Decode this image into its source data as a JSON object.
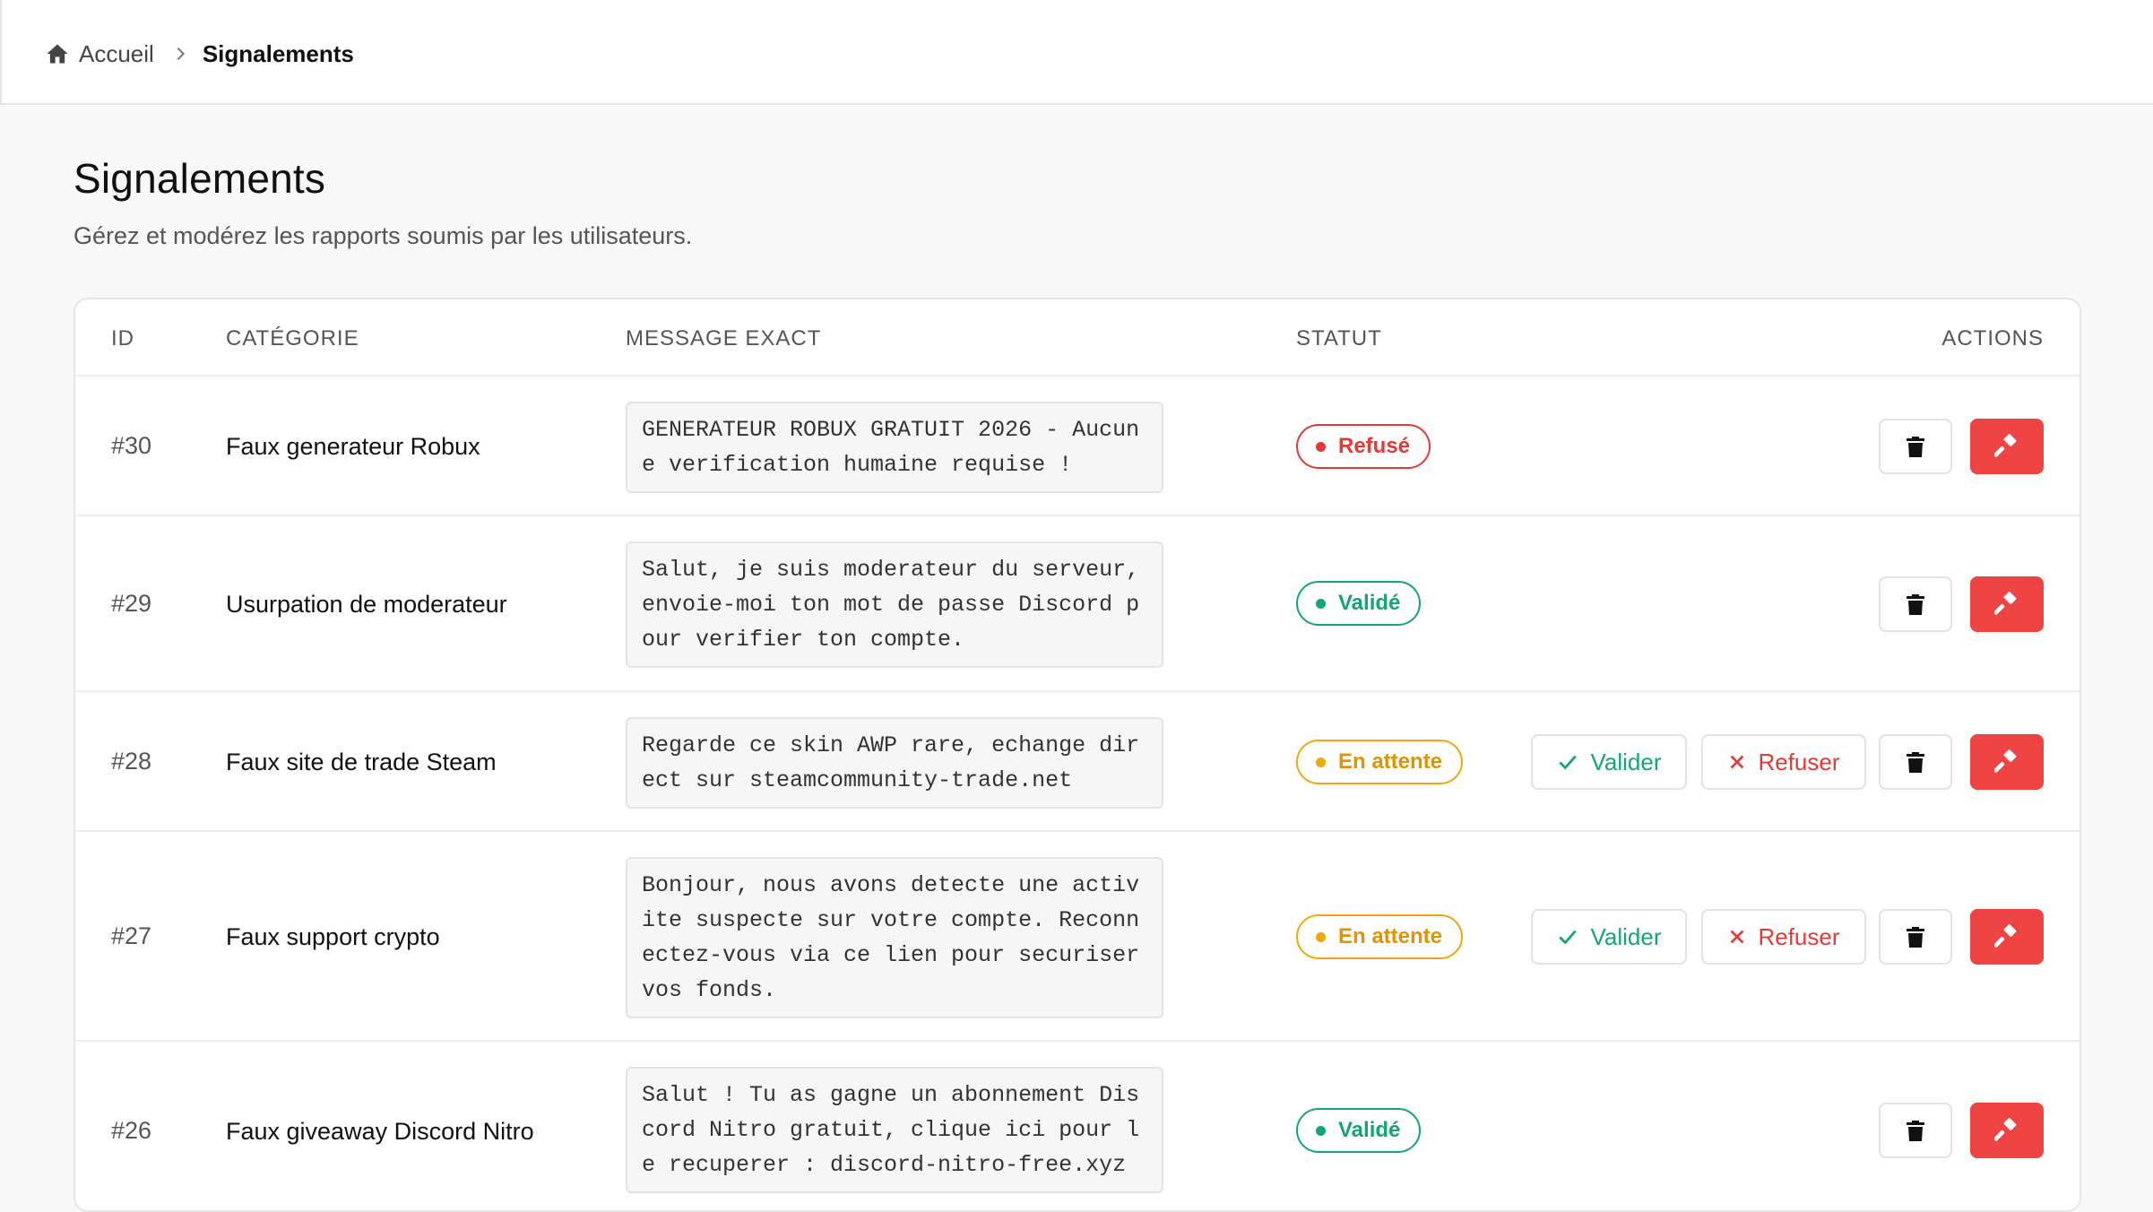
{
  "breadcrumb": {
    "home_label": "Accueil",
    "current_label": "Signalements"
  },
  "header": {
    "title": "Signalements",
    "subtitle": "Gérez et modérez les rapports soumis par les utilisateurs."
  },
  "table": {
    "columns": {
      "id": "ID",
      "category": "CATÉGORIE",
      "message": "MESSAGE EXACT",
      "status": "STATUT",
      "actions": "ACTIONS"
    },
    "rows": [
      {
        "id": "#30",
        "category": "Faux generateur Robux",
        "message": "GENERATEUR ROBUX GRATUIT 2026 - Aucune verification humaine requise !",
        "status": "Refusé"
      },
      {
        "id": "#29",
        "category": "Usurpation de moderateur",
        "message": "Salut, je suis moderateur du serveur, envoie-moi ton mot de passe Discord pour verifier ton compte.",
        "status": "Validé"
      },
      {
        "id": "#28",
        "category": "Faux site de trade Steam",
        "message": "Regarde ce skin AWP rare, echange direct sur steamcommunity-trade.net",
        "status": "En attente"
      },
      {
        "id": "#27",
        "category": "Faux support crypto",
        "message": "Bonjour, nous avons detecte une activite suspecte sur votre compte. Reconnectez-vous via ce lien pour securiser vos fonds.",
        "status": "En attente"
      },
      {
        "id": "#26",
        "category": "Faux giveaway Discord Nitro",
        "message": "Salut ! Tu as gagne un abonnement Discord Nitro gratuit, clique ici pour le recuperer : discord-nitro-free.xyz",
        "status": "Validé"
      }
    ]
  },
  "actions": {
    "validate_label": "Valider",
    "refuse_label": "Refuser"
  },
  "colors": {
    "danger": "#ef4444",
    "success": "#14a672",
    "warning": "#f0a80c"
  },
  "icons": {
    "home": "home-icon",
    "separator": "chevron-right-icon",
    "delete": "trash-icon",
    "ban": "hammer-icon",
    "validate": "check-icon",
    "refuse": "x-icon"
  }
}
